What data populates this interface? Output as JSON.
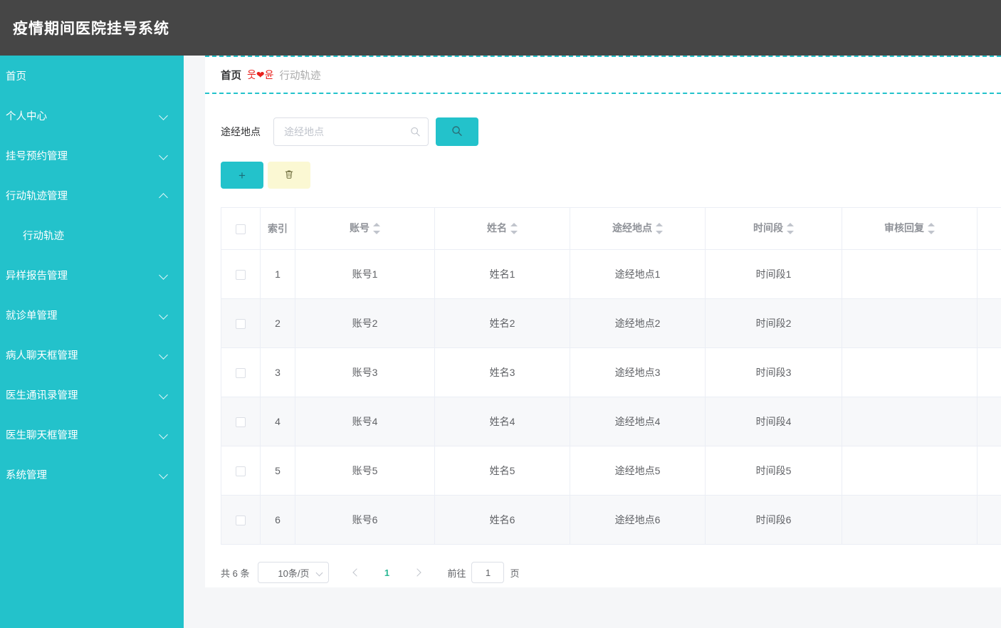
{
  "header": {
    "title": "疫情期间医院挂号系统"
  },
  "sidebar": {
    "items": [
      {
        "label": "首页",
        "type": "link",
        "icon": "none"
      },
      {
        "label": "个人中心",
        "type": "group",
        "icon": "chevron-down-icon"
      },
      {
        "label": "挂号预约管理",
        "type": "group",
        "icon": "chevron-down-icon"
      },
      {
        "label": "行动轨迹管理",
        "type": "group",
        "icon": "chevron-up-icon",
        "expanded": true
      },
      {
        "label": "行动轨迹",
        "type": "sub",
        "active": true
      },
      {
        "label": "异样报告管理",
        "type": "group",
        "icon": "chevron-down-icon"
      },
      {
        "label": "就诊单管理",
        "type": "group",
        "icon": "chevron-down-icon"
      },
      {
        "label": "病人聊天框管理",
        "type": "group",
        "icon": "chevron-down-icon"
      },
      {
        "label": "医生通讯录管理",
        "type": "group",
        "icon": "chevron-down-icon"
      },
      {
        "label": "医生聊天框管理",
        "type": "group",
        "icon": "chevron-down-icon"
      },
      {
        "label": "系统管理",
        "type": "group",
        "icon": "chevron-down-icon"
      }
    ]
  },
  "breadcrumb": {
    "home": "首页",
    "separator": "웃❤윤",
    "current": "行动轨迹"
  },
  "search": {
    "label": "途经地点",
    "placeholder": "途经地点",
    "value": "",
    "button_icon": "search-icon"
  },
  "toolbar": {
    "add_label": "+",
    "delete_icon": "trash-icon"
  },
  "table": {
    "columns": [
      {
        "key": "checkbox",
        "label": "",
        "sortable": false
      },
      {
        "key": "index",
        "label": "索引",
        "sortable": false
      },
      {
        "key": "account",
        "label": "账号",
        "sortable": true
      },
      {
        "key": "name",
        "label": "姓名",
        "sortable": true
      },
      {
        "key": "place",
        "label": "途经地点",
        "sortable": true
      },
      {
        "key": "period",
        "label": "时间段",
        "sortable": true
      },
      {
        "key": "reply",
        "label": "审核回复",
        "sortable": true
      },
      {
        "key": "extra",
        "label": "",
        "sortable": false
      }
    ],
    "rows": [
      {
        "index": "1",
        "account": "账号1",
        "name": "姓名1",
        "place": "途经地点1",
        "period": "时间段1",
        "reply": "",
        "extra": ""
      },
      {
        "index": "2",
        "account": "账号2",
        "name": "姓名2",
        "place": "途经地点2",
        "period": "时间段2",
        "reply": "",
        "extra": ""
      },
      {
        "index": "3",
        "account": "账号3",
        "name": "姓名3",
        "place": "途经地点3",
        "period": "时间段3",
        "reply": "",
        "extra": ""
      },
      {
        "index": "4",
        "account": "账号4",
        "name": "姓名4",
        "place": "途经地点4",
        "period": "时间段4",
        "reply": "",
        "extra": ""
      },
      {
        "index": "5",
        "account": "账号5",
        "name": "姓名5",
        "place": "途经地点5",
        "period": "时间段5",
        "reply": "",
        "extra": ""
      },
      {
        "index": "6",
        "account": "账号6",
        "name": "姓名6",
        "place": "途经地点6",
        "period": "时间段6",
        "reply": "",
        "extra": ""
      }
    ]
  },
  "pagination": {
    "total_text": "共 6 条",
    "page_size_label": "10条/页",
    "current_page": "1",
    "jump_label": "前往",
    "jump_value": "1",
    "jump_suffix": "页"
  },
  "colors": {
    "sidebar": "#23c2cb",
    "header": "#464646",
    "accent": "#23c2cb",
    "page_active": "#2bb894",
    "delete_button": "#fbf8d3",
    "separator": "#e8201c"
  }
}
